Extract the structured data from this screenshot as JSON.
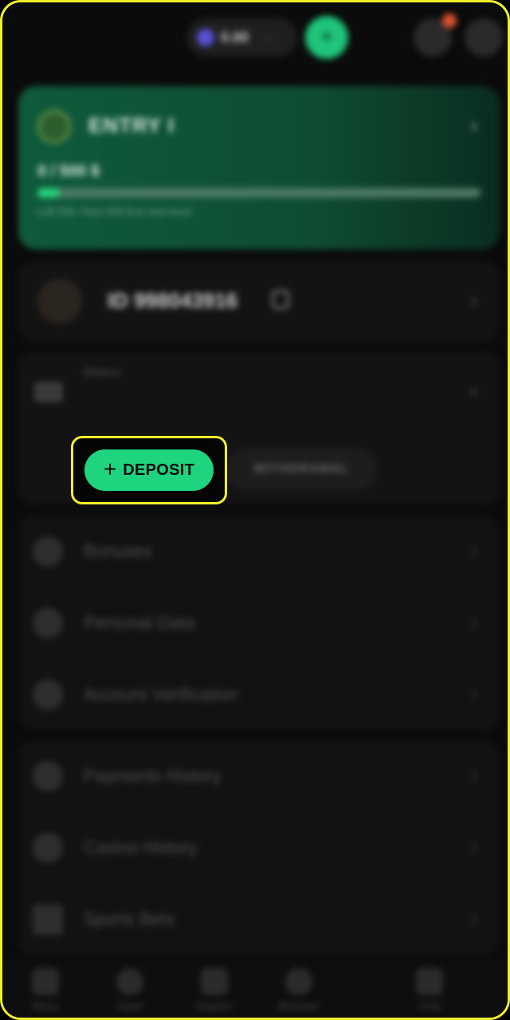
{
  "header": {
    "balance": "0.00",
    "coin_icon": "coin-icon",
    "action_icon": "plus-icon",
    "notification_icon": "bell-icon"
  },
  "level": {
    "title": "ENTRY I",
    "progress_text": "0 / 500 $",
    "progress_fraction": 0.05,
    "hint": "Left 500 / from 500 $ to next level"
  },
  "profile": {
    "user_id": "ID 998043916"
  },
  "balance_section": {
    "label": "Balance",
    "deposit_plus": "+",
    "deposit_label": "DEPOSIT",
    "withdraw_label": "WITHDRAWAL"
  },
  "menu_group_a": [
    {
      "label": "Bonuses",
      "icon": "gift-icon"
    },
    {
      "label": "Personal Data",
      "icon": "user-icon"
    },
    {
      "label": "Account Verification",
      "icon": "shield-icon"
    }
  ],
  "menu_group_b": [
    {
      "label": "Payments History",
      "icon": "history-icon"
    },
    {
      "label": "Casino History",
      "icon": "casino-icon"
    },
    {
      "label": "Sports Bets",
      "icon": "ticket-icon"
    }
  ],
  "bottom_nav": [
    {
      "label": "Menu"
    },
    {
      "label": "Sport"
    },
    {
      "label": "Esports"
    },
    {
      "label": "Bonuses"
    },
    {
      "label": "Chat"
    }
  ],
  "colors": {
    "accent": "#1fd47f",
    "highlight": "#f2ef2a",
    "background": "#0b0b0b"
  }
}
